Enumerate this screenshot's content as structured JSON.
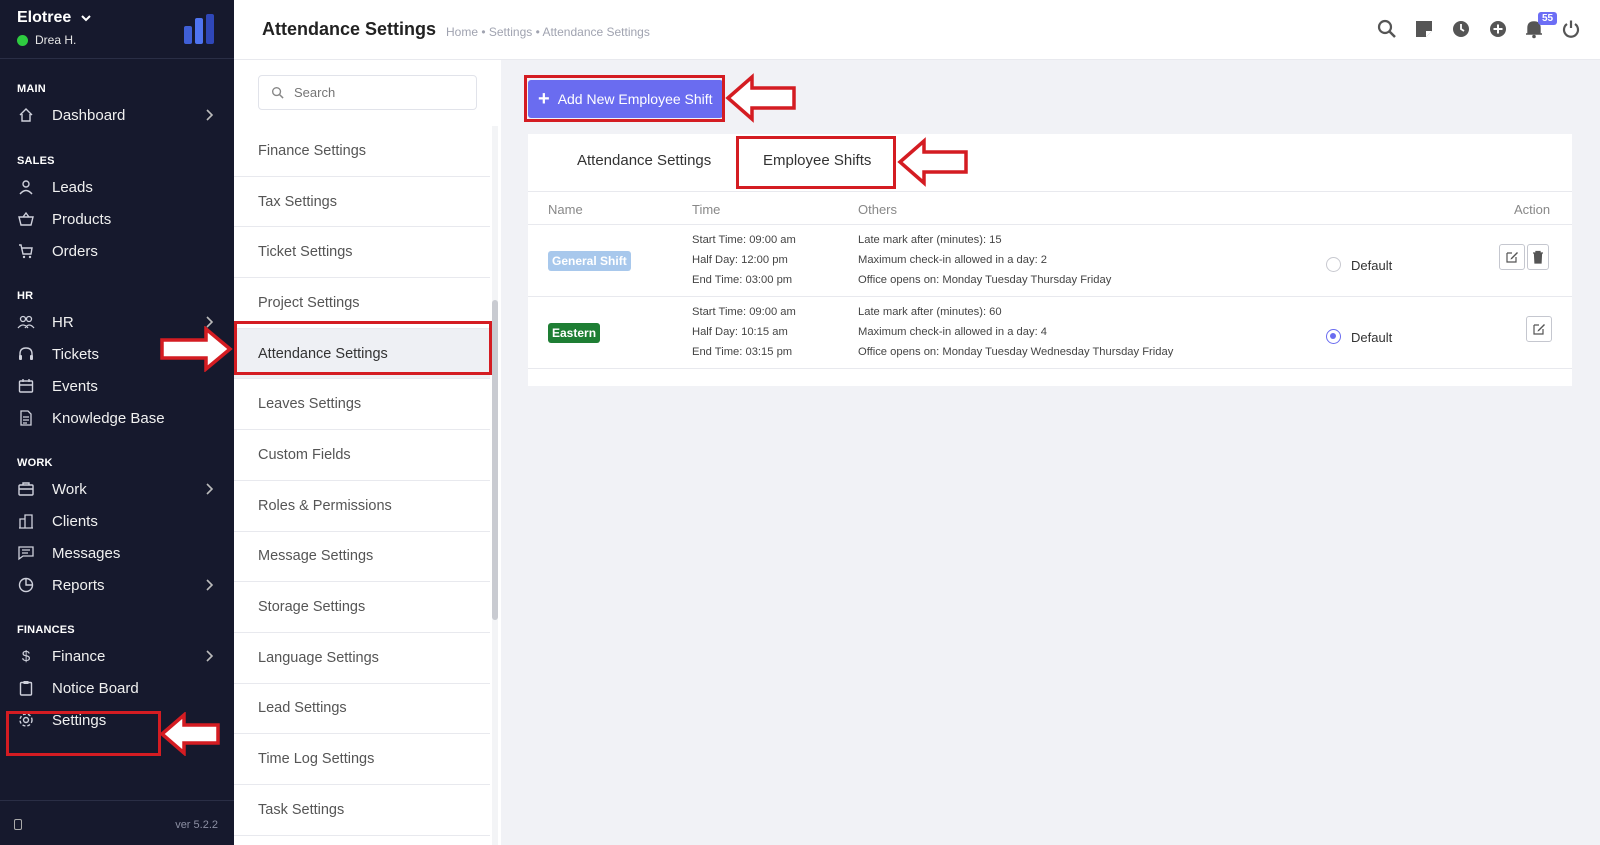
{
  "sidebar": {
    "company": "Elotree",
    "user": "Drea H.",
    "version": "ver 5.2.2",
    "sections": [
      {
        "label": "MAIN"
      },
      {
        "label": "SALES"
      },
      {
        "label": "HR"
      },
      {
        "label": "WORK"
      },
      {
        "label": "FINANCES"
      }
    ],
    "items": [
      {
        "label": "Dashboard",
        "icon": "home-icon"
      },
      {
        "label": "Leads",
        "icon": "user-icon"
      },
      {
        "label": "Products",
        "icon": "basket-icon"
      },
      {
        "label": "Orders",
        "icon": "cart-icon"
      },
      {
        "label": "HR",
        "icon": "people-icon"
      },
      {
        "label": "Tickets",
        "icon": "headset-icon"
      },
      {
        "label": "Events",
        "icon": "calendar-icon"
      },
      {
        "label": "Knowledge Base",
        "icon": "document-icon"
      },
      {
        "label": "Work",
        "icon": "briefcase-icon"
      },
      {
        "label": "Clients",
        "icon": "building-icon"
      },
      {
        "label": "Messages",
        "icon": "message-icon"
      },
      {
        "label": "Reports",
        "icon": "pie-chart-icon"
      },
      {
        "label": "Finance",
        "icon": "dollar-icon"
      },
      {
        "label": "Notice Board",
        "icon": "clipboard-icon"
      },
      {
        "label": "Settings",
        "icon": "gear-icon"
      }
    ]
  },
  "header": {
    "title": "Attendance Settings",
    "breadcrumb": "Home • Settings • Attendance Settings",
    "notification_count": "55"
  },
  "settings_nav": {
    "search_placeholder": "Search",
    "items": [
      "Finance Settings",
      "Tax Settings",
      "Ticket Settings",
      "Project Settings",
      "Attendance Settings",
      "Leaves Settings",
      "Custom Fields",
      "Roles & Permissions",
      "Message Settings",
      "Storage Settings",
      "Language Settings",
      "Lead Settings",
      "Time Log Settings",
      "Task Settings"
    ],
    "active": "Attendance Settings"
  },
  "main": {
    "add_button": "Add New Employee Shift",
    "tabs": [
      "Attendance Settings",
      "Employee Shifts"
    ],
    "active_tab": "Employee Shifts",
    "columns": [
      "Name",
      "Time",
      "Others",
      "Action"
    ],
    "shifts": [
      {
        "name": "General Shift",
        "color": "#a8c8ec",
        "start": "Start Time: 09:00 am",
        "half": "Half Day: 12:00 pm",
        "end": "End Time: 03:00 pm",
        "late": "Late mark after (minutes): 15",
        "checkin": "Maximum check-in allowed in a day: 2",
        "opens": "Office opens on: Monday Tuesday Thursday Friday",
        "default_label": "Default",
        "is_default": false
      },
      {
        "name": "Eastern",
        "color": "#1e7e34",
        "start": "Start Time: 09:00 am",
        "half": "Half Day: 10:15 am",
        "end": "End Time: 03:15 pm",
        "late": "Late mark after (minutes): 60",
        "checkin": "Maximum check-in allowed in a day: 4",
        "opens": "Office opens on: Monday Tuesday Wednesday Thursday Friday",
        "default_label": "Default",
        "is_default": true
      }
    ]
  },
  "colors": {
    "sidebar_bg": "#16192d",
    "accent": "#6a6cf0",
    "annotation_red": "#d41c22"
  }
}
